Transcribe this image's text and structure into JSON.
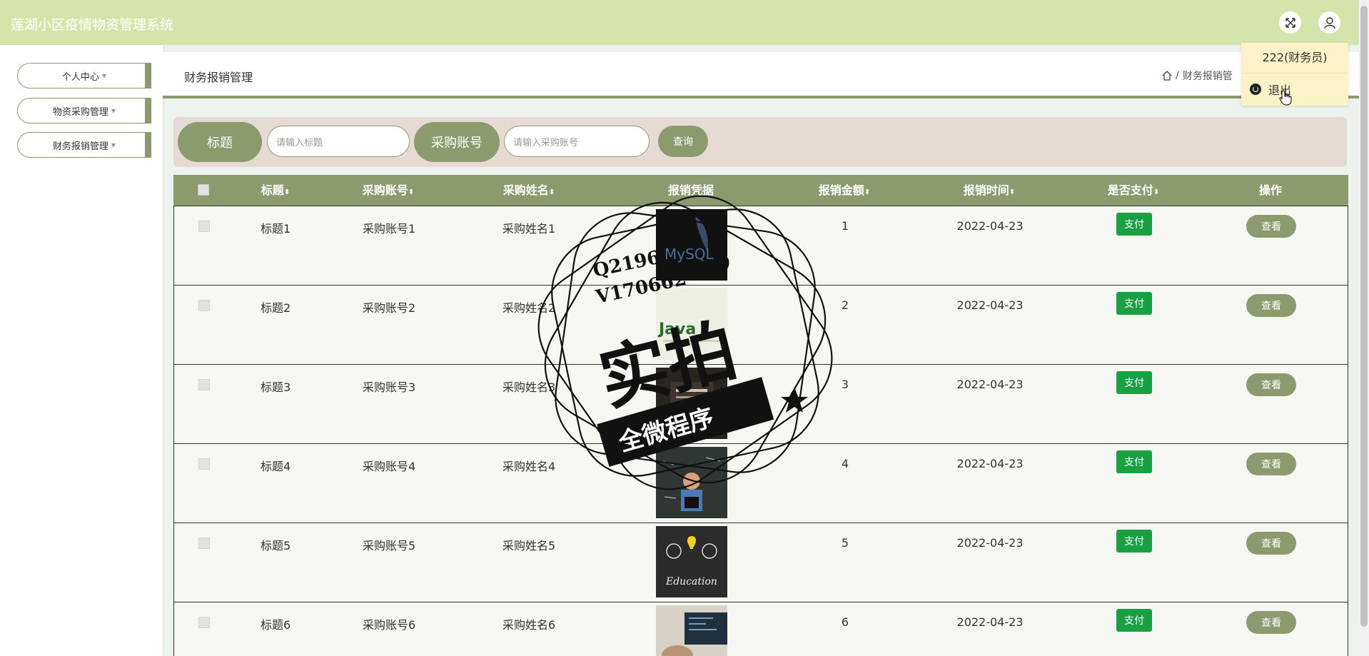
{
  "app_title": "莲湖小区疫情物资管理系统",
  "user_menu": {
    "username": "222(财务员)",
    "logout_label": "退出"
  },
  "sidebar": {
    "items": [
      {
        "label": "个人中心",
        "caret": "▼"
      },
      {
        "label": "物资采购管理",
        "caret": "▼"
      },
      {
        "label": "财务报销管理",
        "caret": "▼"
      }
    ]
  },
  "page": {
    "title": "财务报销管理",
    "breadcrumb_sep": "/",
    "breadcrumb_current": "财务报销管"
  },
  "search": {
    "title_label": "标题",
    "title_placeholder": "请输入标题",
    "account_label": "采购账号",
    "account_placeholder": "请输入采购账号",
    "query_button": "查询"
  },
  "table": {
    "headers": {
      "title": "标题",
      "account": "采购账号",
      "name": "采购姓名",
      "voucher": "报销凭据",
      "amount": "报销金额",
      "time": "报销时间",
      "paid": "是否支付",
      "actions": "操作",
      "sort_icon": "⬍"
    },
    "rows": [
      {
        "title": "标题1",
        "account": "采购账号1",
        "name": "采购姓名1",
        "amount": "1",
        "time": "2022-04-23",
        "pay": "支付",
        "view": "查看",
        "thumb_icon": "mysql-logo"
      },
      {
        "title": "标题2",
        "account": "采购账号2",
        "name": "采购姓名2",
        "amount": "2",
        "time": "2022-04-23",
        "pay": "支付",
        "view": "查看",
        "thumb_icon": "java-logo"
      },
      {
        "title": "标题3",
        "account": "采购账号3",
        "name": "采购姓名3",
        "amount": "3",
        "time": "2022-04-23",
        "pay": "支付",
        "view": "查看",
        "thumb_icon": "book-cover"
      },
      {
        "title": "标题4",
        "account": "采购账号4",
        "name": "采购姓名4",
        "amount": "4",
        "time": "2022-04-23",
        "pay": "支付",
        "view": "查看",
        "thumb_icon": "classroom-photo"
      },
      {
        "title": "标题5",
        "account": "采购账号5",
        "name": "采购姓名5",
        "amount": "5",
        "time": "2022-04-23",
        "pay": "支付",
        "view": "查看",
        "thumb_icon": "education-chalkboard"
      },
      {
        "title": "标题6",
        "account": "采购账号6",
        "name": "采购姓名6",
        "amount": "6",
        "time": "2022-04-23",
        "pay": "支付",
        "view": "查看",
        "thumb_icon": "laptop-code-photo"
      }
    ]
  },
  "watermark": {
    "line1": "Q2196",
    "line1_end": "9",
    "line2": "V170662",
    "main": "实拍",
    "ribbon": "全微程序",
    "mysql_text": "MySQL",
    "java_text": "Java",
    "education_text": "Education"
  },
  "colors": {
    "topbar": "#d5e4aa",
    "accent": "#8c9b6e",
    "pay_green": "#19a042",
    "search_bg": "#e6dad5",
    "dropdown_bg": "#fbf3c7"
  }
}
